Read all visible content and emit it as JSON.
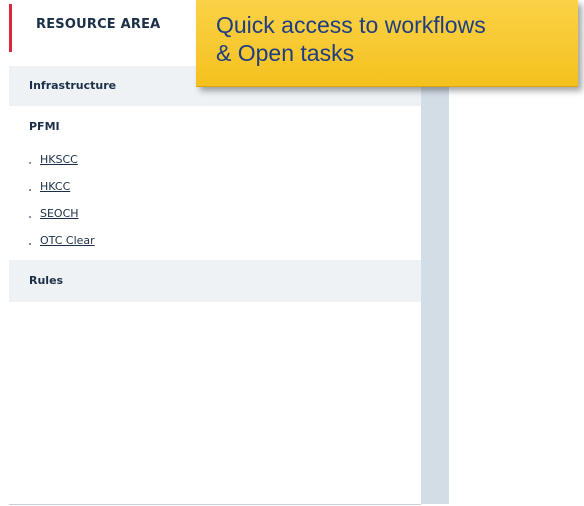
{
  "panel": {
    "title": "RESOURCE AREA",
    "accent_color": "#d6283a",
    "sections": {
      "infrastructure": "Infrastructure",
      "pfmi": {
        "title": "PFMI",
        "links": [
          "HKSCC",
          "HKCC",
          "SEOCH",
          "OTC Clear"
        ]
      },
      "rules": "Rules"
    }
  },
  "callout": {
    "line1": "Quick access to workflows",
    "line2": "& Open tasks",
    "background_color": "#f4c11e",
    "text_color": "#1f3d82"
  }
}
